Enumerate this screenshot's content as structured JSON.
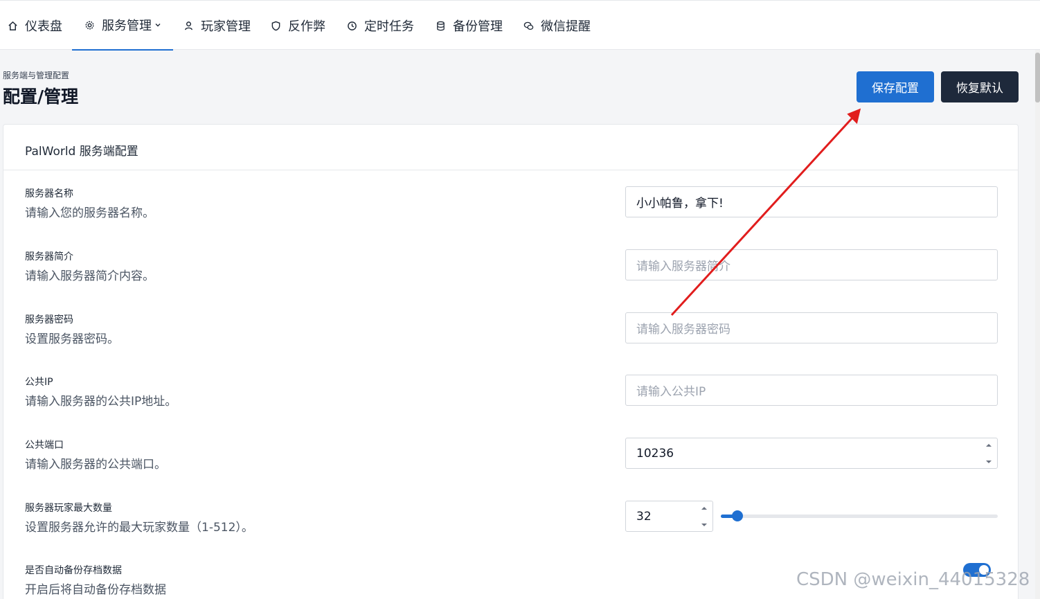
{
  "nav": {
    "items": [
      {
        "label": "仪表盘",
        "icon": "home-icon"
      },
      {
        "label": "服务管理",
        "icon": "gear-icon",
        "active": true,
        "dropdown": true
      },
      {
        "label": "玩家管理",
        "icon": "user-icon"
      },
      {
        "label": "反作弊",
        "icon": "shield-icon"
      },
      {
        "label": "定时任务",
        "icon": "clock-icon"
      },
      {
        "label": "备份管理",
        "icon": "database-icon"
      },
      {
        "label": "微信提醒",
        "icon": "wechat-icon"
      }
    ]
  },
  "header": {
    "breadcrumb": "服务端与管理配置",
    "title": "配置/管理",
    "save_label": "保存配置",
    "reset_label": "恢复默认"
  },
  "card": {
    "title": "PalWorld 服务端配置",
    "fields": [
      {
        "label": "服务器名称",
        "desc": "请输入您的服务器名称。",
        "value": "小小帕鲁，拿下!",
        "placeholder": ""
      },
      {
        "label": "服务器简介",
        "desc": "请输入服务器简介内容。",
        "value": "",
        "placeholder": "请输入服务器简介"
      },
      {
        "label": "服务器密码",
        "desc": "设置服务器密码。",
        "value": "",
        "placeholder": "请输入服务器密码"
      },
      {
        "label": "公共IP",
        "desc": "请输入服务器的公共IP地址。",
        "value": "",
        "placeholder": "请输入公共IP"
      },
      {
        "label": "公共端口",
        "desc": "请输入服务器的公共端口。",
        "value": "10236",
        "placeholder": ""
      },
      {
        "label": "服务器玩家最大数量",
        "desc": "设置服务器允许的最大玩家数量（1-512）。",
        "value": "32",
        "slider_fraction": 0.06
      },
      {
        "label": "是否自动备份存档数据",
        "desc": "开启后将自动备份存档数据",
        "toggle": true
      }
    ]
  },
  "watermark": "CSDN @weixin_44015328",
  "colors": {
    "accent": "#1f6fd1",
    "dark_button": "#1e293b",
    "annotation_arrow": "#e11d1d"
  }
}
